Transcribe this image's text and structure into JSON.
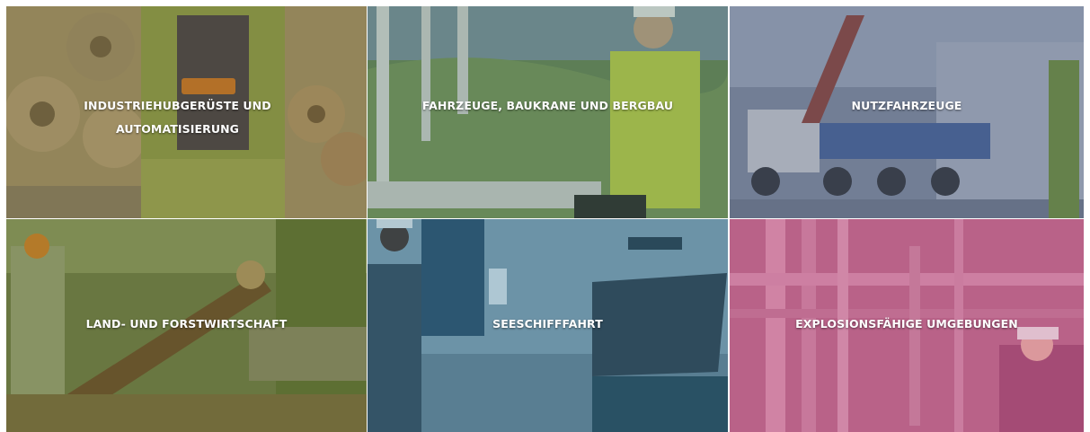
{
  "tiles": [
    {
      "id": "industrial",
      "lines": [
        "INDUSTRIEHUBGERÜSTE UND",
        "AUTOMATISIERUNG"
      ],
      "tint": "#7b6a3a"
    },
    {
      "id": "vehicles",
      "lines": [
        "FAHRZEUGE, BAUKRANE UND BERGBAU"
      ],
      "tint": "#4b6a52"
    },
    {
      "id": "commercial",
      "lines": [
        "NUTZFAHRZEUGE"
      ],
      "tint": "#5a6a86"
    },
    {
      "id": "agriculture",
      "lines": [
        "LAND- UND FORSTWIRTSCHAFT"
      ],
      "tint": "#6a7a3a"
    },
    {
      "id": "maritime",
      "lines": [
        "SEESCHIFFFAHRT"
      ],
      "tint": "#2f6e86"
    },
    {
      "id": "hazardous",
      "lines": [
        "EXPLOSIONSFÄHIGE UMGEBUNGEN"
      ],
      "tint": "#b0507a"
    }
  ]
}
